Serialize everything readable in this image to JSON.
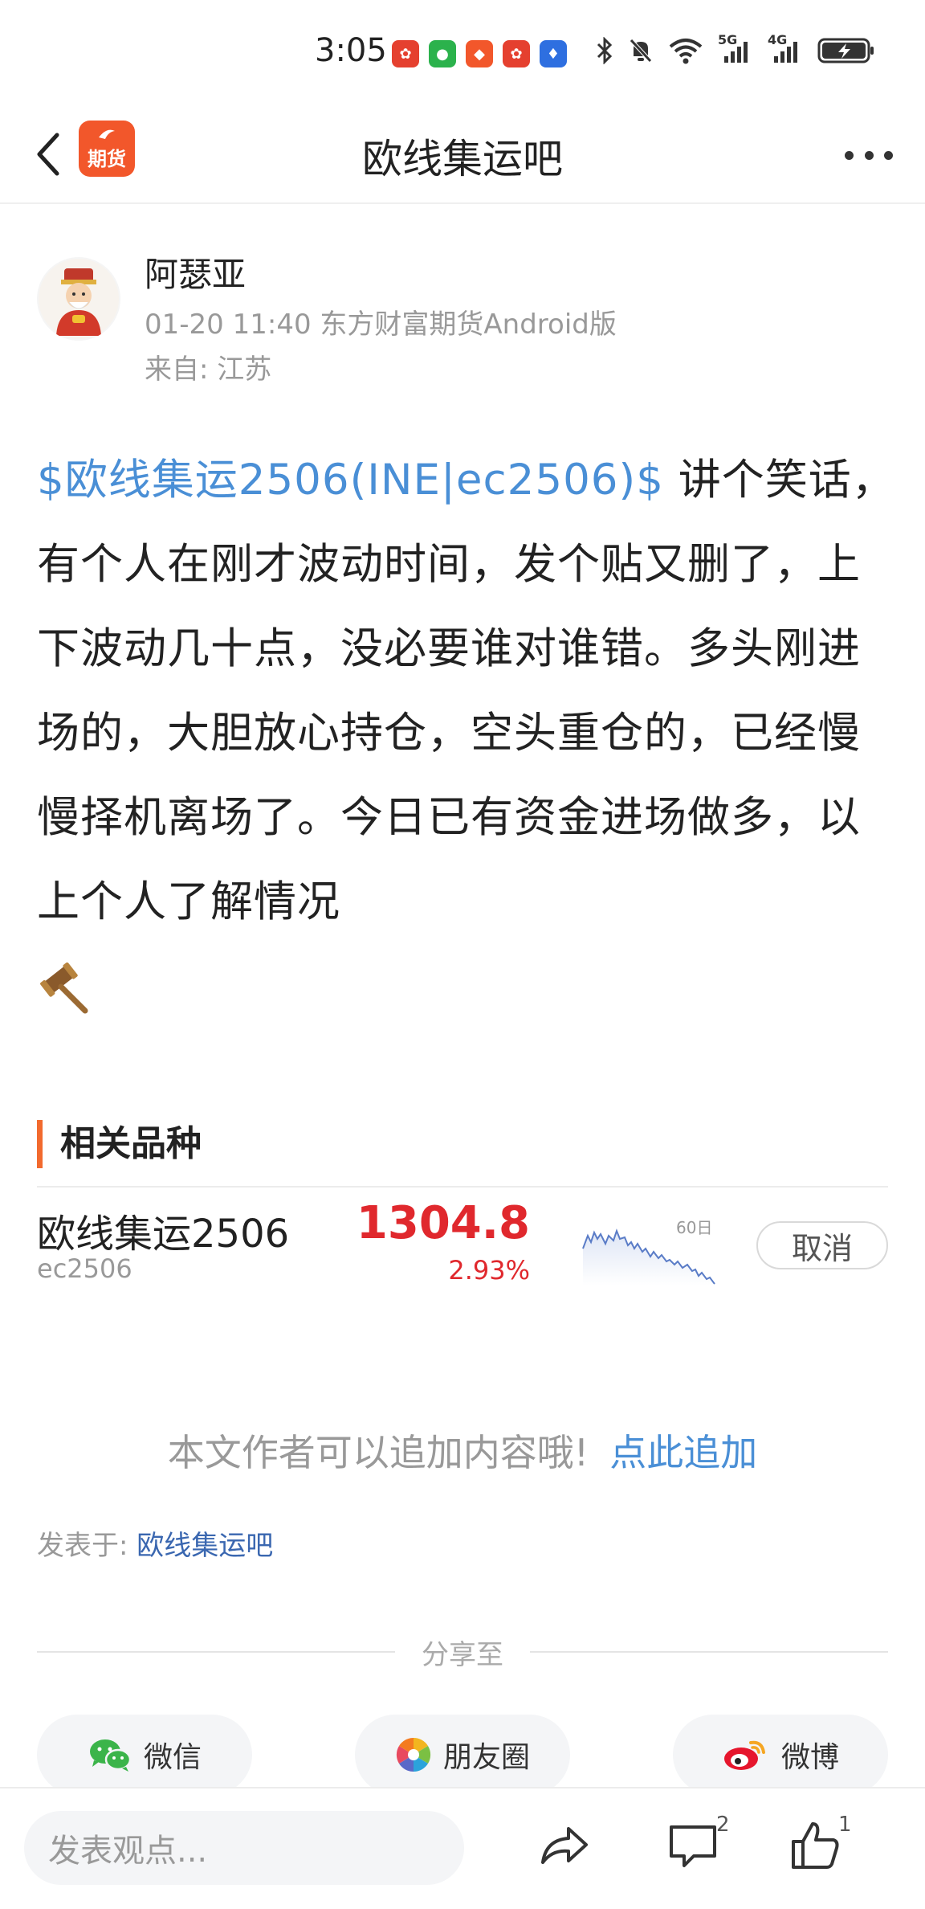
{
  "status": {
    "time": "3:05",
    "net1": "5G",
    "net2": "4G"
  },
  "header": {
    "title": "欧线集运吧",
    "app_logo_text": "期货"
  },
  "post": {
    "author": "阿瑟亚",
    "meta": "01-20 11:40 东方财富期货Android版",
    "location": "来自: 江苏",
    "stock_link": "$欧线集运2506(INE|ec2506)$",
    "body_text": " 讲个笑话，有个人在刚才波动时间，发个贴又删了，上下波动几十点，没必要谁对谁错。多头刚进场的，大胆放心持仓，空头重仓的，已经慢慢择机离场了。今日已有资金进场做多，以上个人了解情况"
  },
  "related": {
    "heading": "相关品种",
    "item": {
      "name": "欧线集运2506",
      "code": "ec2506",
      "price": "1304.8",
      "change": "2.93%",
      "spark_label": "60日",
      "action": "取消"
    }
  },
  "append": {
    "text": "本文作者可以追加内容哦!",
    "link": "点此追加"
  },
  "posted_in": {
    "label": "发表于: ",
    "forum": "欧线集运吧"
  },
  "share": {
    "label": "分享至",
    "wechat": "微信",
    "moments": "朋友圈",
    "weibo": "微博"
  },
  "bottom": {
    "placeholder": "发表观点...",
    "comments": "2",
    "likes": "1"
  },
  "colors": {
    "accent_orange": "#f26a2e",
    "price_red": "#e0282d",
    "link_blue": "#4a8fd6"
  }
}
